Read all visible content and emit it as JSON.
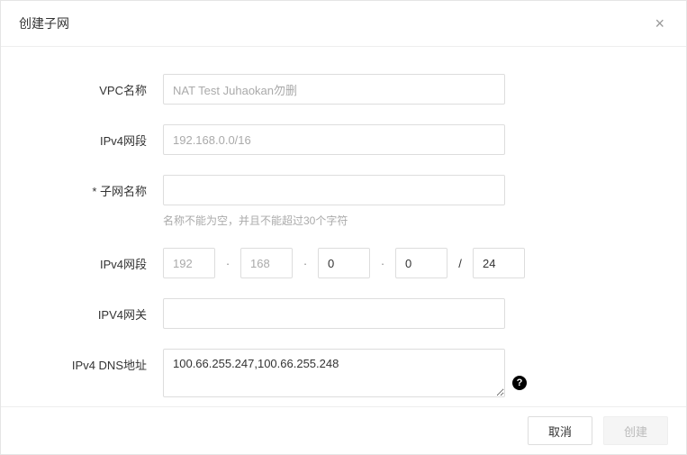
{
  "modal": {
    "title": "创建子网",
    "close_label": "×"
  },
  "form": {
    "vpc_name": {
      "label": "VPC名称",
      "value": "NAT Test Juhaokan勿删"
    },
    "ipv4_range": {
      "label": "IPv4网段",
      "value": "192.168.0.0/16"
    },
    "subnet_name": {
      "label": "* 子网名称",
      "value": "",
      "helper": "名称不能为空，并且不能超过30个字符"
    },
    "ipv4_cidr": {
      "label": "IPv4网段",
      "oct1": "192",
      "oct2": "168",
      "oct3": "0",
      "oct4": "0",
      "mask": "24",
      "dot": "·",
      "slash": "/"
    },
    "ipv4_gateway": {
      "label": "IPV4网关",
      "value": ""
    },
    "ipv4_dns": {
      "label": "IPv4 DNS地址",
      "value": "100.66.255.247,100.66.255.248",
      "help_symbol": "?"
    }
  },
  "footer": {
    "cancel": "取消",
    "create": "创建"
  }
}
